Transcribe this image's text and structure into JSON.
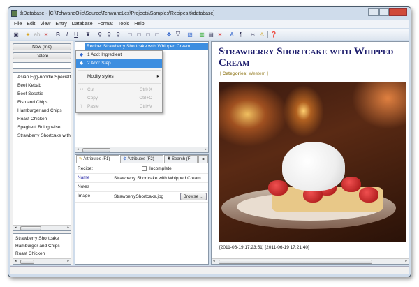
{
  "window": {
    "title": "tkDatabase - [C:\\TchwaneOlie\\Source\\TchwaneLex\\Projects\\Samples\\Recipes.tkdatabase]"
  },
  "menu": [
    "File",
    "Edit",
    "View",
    "Entry",
    "Database",
    "Format",
    "Tools",
    "Help"
  ],
  "left": {
    "new_label": "New (Ins)",
    "delete_label": "Delete",
    "entries": [
      "Asian Egg-noodle Specialty",
      "Beef Kebab",
      "Beef Sosatie",
      "Fish and Chips",
      "Hamburger and Chips",
      "Roast Chicken",
      "Spaghetti Bolognaise",
      "Strawberry Shortcake with Whipped Cream"
    ],
    "history": [
      "Strawberry Shortcake",
      "Hamburger and Chips",
      "Roast Chicken"
    ]
  },
  "tree": {
    "root": "Recipe: Strawberry Shortcake with Whipped Cream"
  },
  "context_menu": {
    "items": [
      {
        "label": "1 Add: Ingredient",
        "shortcut": ""
      },
      {
        "label": "2 Add: Step",
        "shortcut": ""
      },
      {
        "label": "Modify styles",
        "shortcut": ""
      },
      {
        "label": "Cut",
        "shortcut": "Ctrl+X"
      },
      {
        "label": "Copy",
        "shortcut": "Ctrl+C"
      },
      {
        "label": "Paste",
        "shortcut": "Ctrl+V"
      }
    ]
  },
  "tabs": [
    "Attributes (F1)",
    "Attributes (F2)",
    "Search (F"
  ],
  "attributes": {
    "recipe_label": "Recipe:",
    "incomplete_label": "Incomplete",
    "name_label": "Name",
    "name_value": "Strawberry Shortcake with Whipped Cream",
    "notes_label": "Notes",
    "image_label": "Image",
    "image_value": "StrawberryShortcake.jpg",
    "browse_label": "Browse ..."
  },
  "preview": {
    "title": "Strawberry Shortcake with Whipped Cream",
    "categories_open": "[ ",
    "categories_label": "Categories:",
    "categories_value": "Western",
    "categories_close": " ]",
    "timestamp": "[2011-06-19 17:23:51] [2011-06-19 17:21:40]"
  },
  "colors": {
    "selection": "#3d8ee0",
    "title": "#1c1c6c",
    "category": "#a08a3a"
  }
}
